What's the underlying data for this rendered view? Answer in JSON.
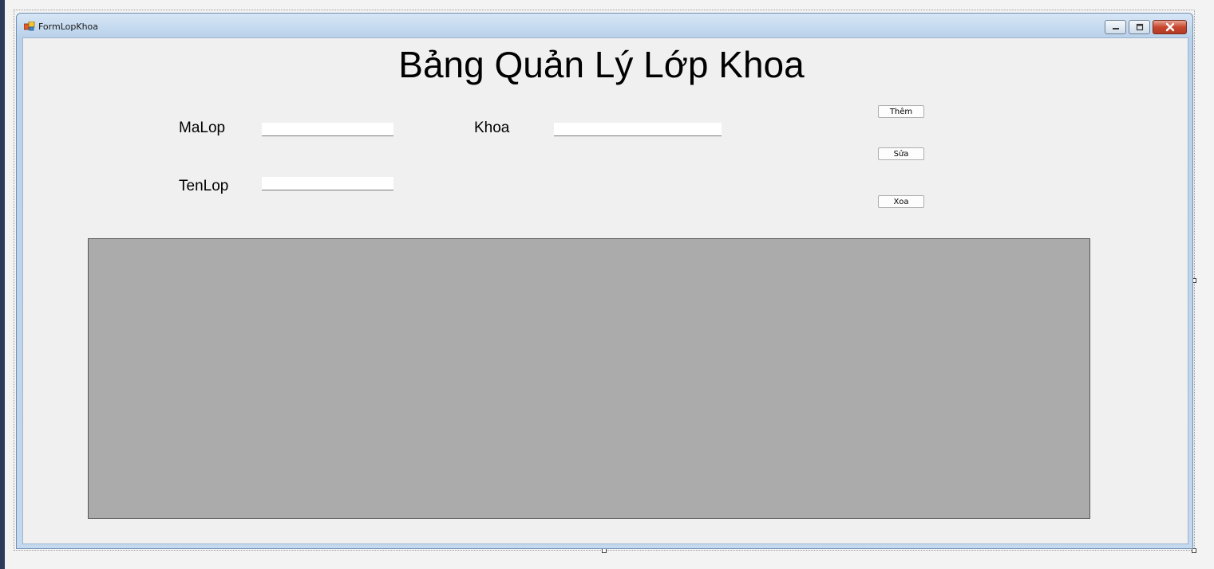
{
  "window": {
    "title": "FormLopKhoa"
  },
  "form": {
    "heading": "Bảng Quản Lý Lớp Khoa",
    "fields": {
      "malop_label": "MaLop",
      "malop_value": "",
      "tenlop_label": "TenLop",
      "tenlop_value": "",
      "khoa_label": "Khoa",
      "khoa_value": ""
    },
    "buttons": {
      "add_label": "Thêm",
      "edit_label": "Sửa",
      "delete_label": "Xoa"
    }
  },
  "colors": {
    "grid_background": "#ababab",
    "client_background": "#f0f0f0",
    "close_button": "#c8472f"
  },
  "icons": {
    "app": "form-app-icon",
    "minimize": "minimize-icon",
    "maximize": "maximize-icon",
    "close": "close-icon"
  }
}
